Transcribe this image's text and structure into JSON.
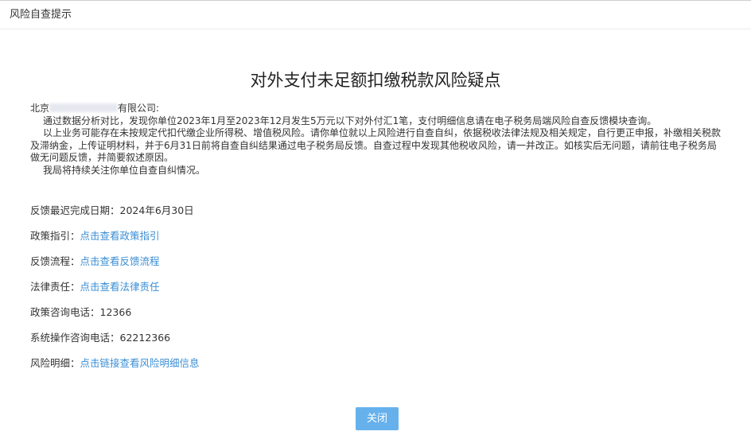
{
  "dialog": {
    "title": "风险自查提示"
  },
  "notice": {
    "heading": "对外支付未足额扣缴税款风险疑点",
    "company_prefix": "北京",
    "company_suffix": "有限公司:",
    "paragraphs": [
      "通过数据分析对比，发现你单位2023年1月至2023年12月发生5万元以下对外付汇1笔，支付明细信息请在电子税务局端风险自查反馈模块查询。",
      "以上业务可能存在未按规定代扣代缴企业所得税、增值税风险。请你单位就以上风险进行自查自纠，依据税收法律法规及相关规定，自行更正申报，补缴相关税款及滞纳金，上传证明材料，并于6月31日前将自查自纠结果通过电子税务局反馈。自查过程中发现其他税收风险，请一并改正。如核实后无问题，请前往电子税务局做无问题反馈，并简要叙述原因。",
      "我局将持续关注你单位自查自纠情况。"
    ]
  },
  "info": {
    "deadline_label": "反馈最迟完成日期：",
    "deadline_value": "2024年6月30日",
    "policy_label": "政策指引：",
    "policy_link": "点击查看政策指引",
    "process_label": "反馈流程：",
    "process_link": "点击查看反馈流程",
    "legal_label": "法律责任：",
    "legal_link": "点击查看法律责任",
    "policy_phone_label": "政策咨询电话：",
    "policy_phone_value": "12366",
    "system_phone_label": "系统操作咨询电话：",
    "system_phone_value": "62212366",
    "risk_detail_label": "风险明细：",
    "risk_detail_link": "点击链接查看风险明细信息"
  },
  "footer": {
    "close_label": "关闭"
  },
  "colors": {
    "link": "#3a8ed3",
    "button": "#66b1ec"
  }
}
